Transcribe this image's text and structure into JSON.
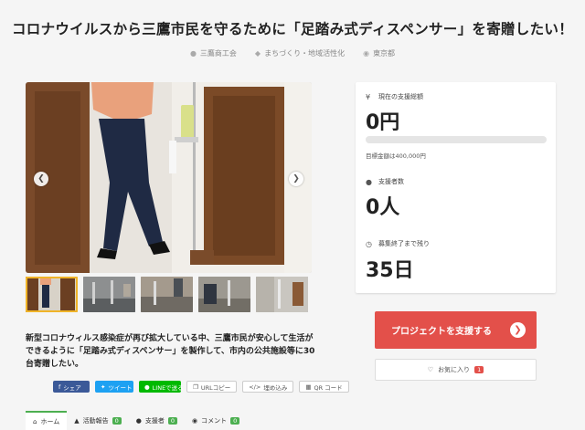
{
  "header": {
    "title": "コロナウイルスから三鷹市民を守るために「足踏み式ディスペンサー」を寄贈したい！",
    "organizer": "三鷹商工会",
    "category": "まちづくり・地域活性化",
    "location": "東京都"
  },
  "description": "新型コロナウィルス感染症が再び拡大している中、三鷹市民が安心して生活ができるように「足踏み式ディスペンサー」を製作して、市内の公共施設等に30台寄贈したい。",
  "share": {
    "facebook": "シェア",
    "twitter": "ツイート",
    "line": "LINEで送る",
    "url_copy": "URLコピー",
    "embed": "埋め込み",
    "qr": "QR コード"
  },
  "tabs": [
    {
      "label": "ホーム",
      "count": null
    },
    {
      "label": "活動報告",
      "count": "0"
    },
    {
      "label": "支援者",
      "count": "0"
    },
    {
      "label": "コメント",
      "count": "0"
    }
  ],
  "stats": {
    "total_label": "現在の支援総額",
    "total_value": "0円",
    "progress": 0,
    "goal_text": "目標金額は400,000円",
    "supporters_label": "支援者数",
    "supporters_value": "0人",
    "remaining_label": "募集終了まで残り",
    "remaining_value": "35日"
  },
  "actions": {
    "support_label": "プロジェクトを支援する",
    "favorite_label": "お気に入り",
    "favorite_count": "1"
  },
  "colors": {
    "accent_red": "#e3504a",
    "tab_green": "#4caf50",
    "thumb_active": "#f0b428"
  }
}
